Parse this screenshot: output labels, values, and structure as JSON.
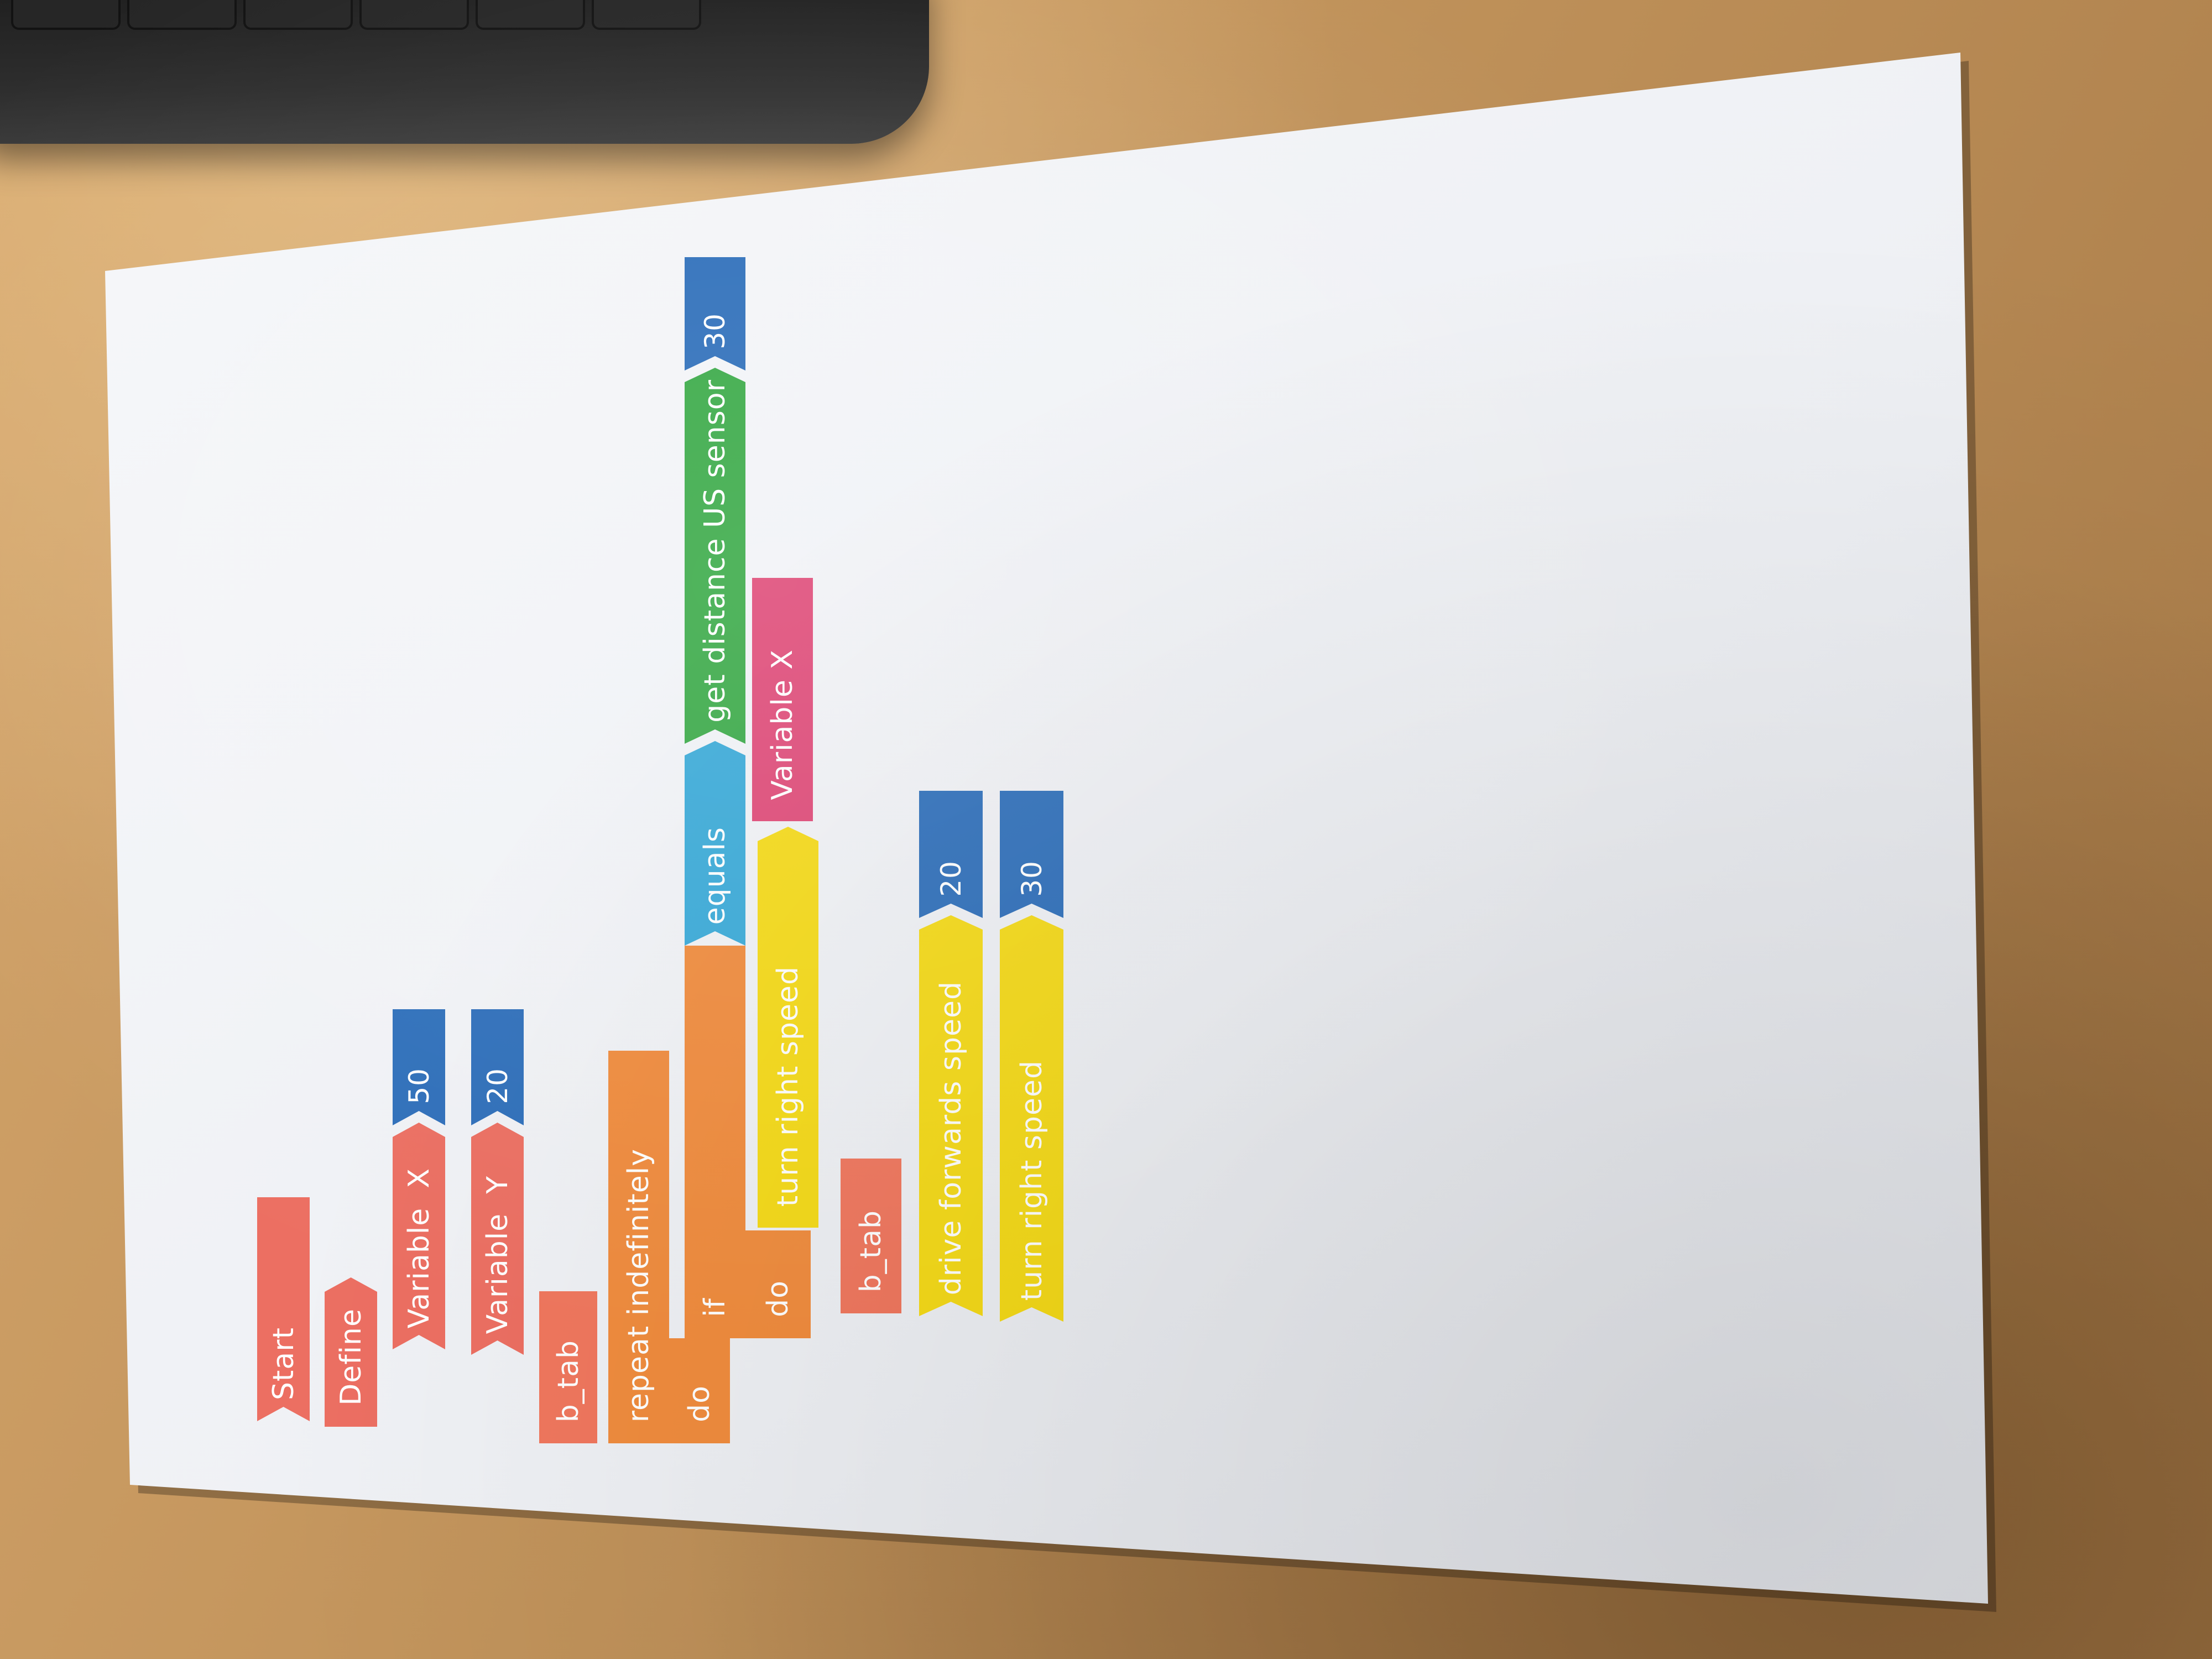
{
  "scene": {
    "paper_color": "#f4f5f8",
    "desk_color": "#c0925a",
    "keyboard_color": "#262626"
  },
  "blocks": {
    "start": "Start",
    "define": "Define",
    "variable_x": "Variable  X",
    "value_50": "50",
    "variable_y": "Variable  Y",
    "value_20_a": "20",
    "b_tab_1": "b_tab",
    "repeat_indefinitely": "repeat indefinitely",
    "do_1": "do",
    "if": "if",
    "do_2": "do",
    "equals": "equals",
    "get_distance_us_sensor": "get distance US sensor",
    "value_30_a": "30",
    "turn_right_speed_1": "turn right speed",
    "variable_x_2": "Variable X",
    "b_tab_2": "b_tab",
    "drive_forwards_speed": "drive forwards speed",
    "value_20_b": "20",
    "turn_right_speed_2": "turn right speed",
    "value_30_b": "30"
  },
  "colors": {
    "event_red": "#ec6f62",
    "control_orange": "#f08c3e",
    "logic_cyan": "#3aaad8",
    "sensor_green": "#3aaa48",
    "variable_magenta": "#df4a78",
    "motor_yellow": "#f5da18",
    "number_blue": "#2e6fba"
  }
}
